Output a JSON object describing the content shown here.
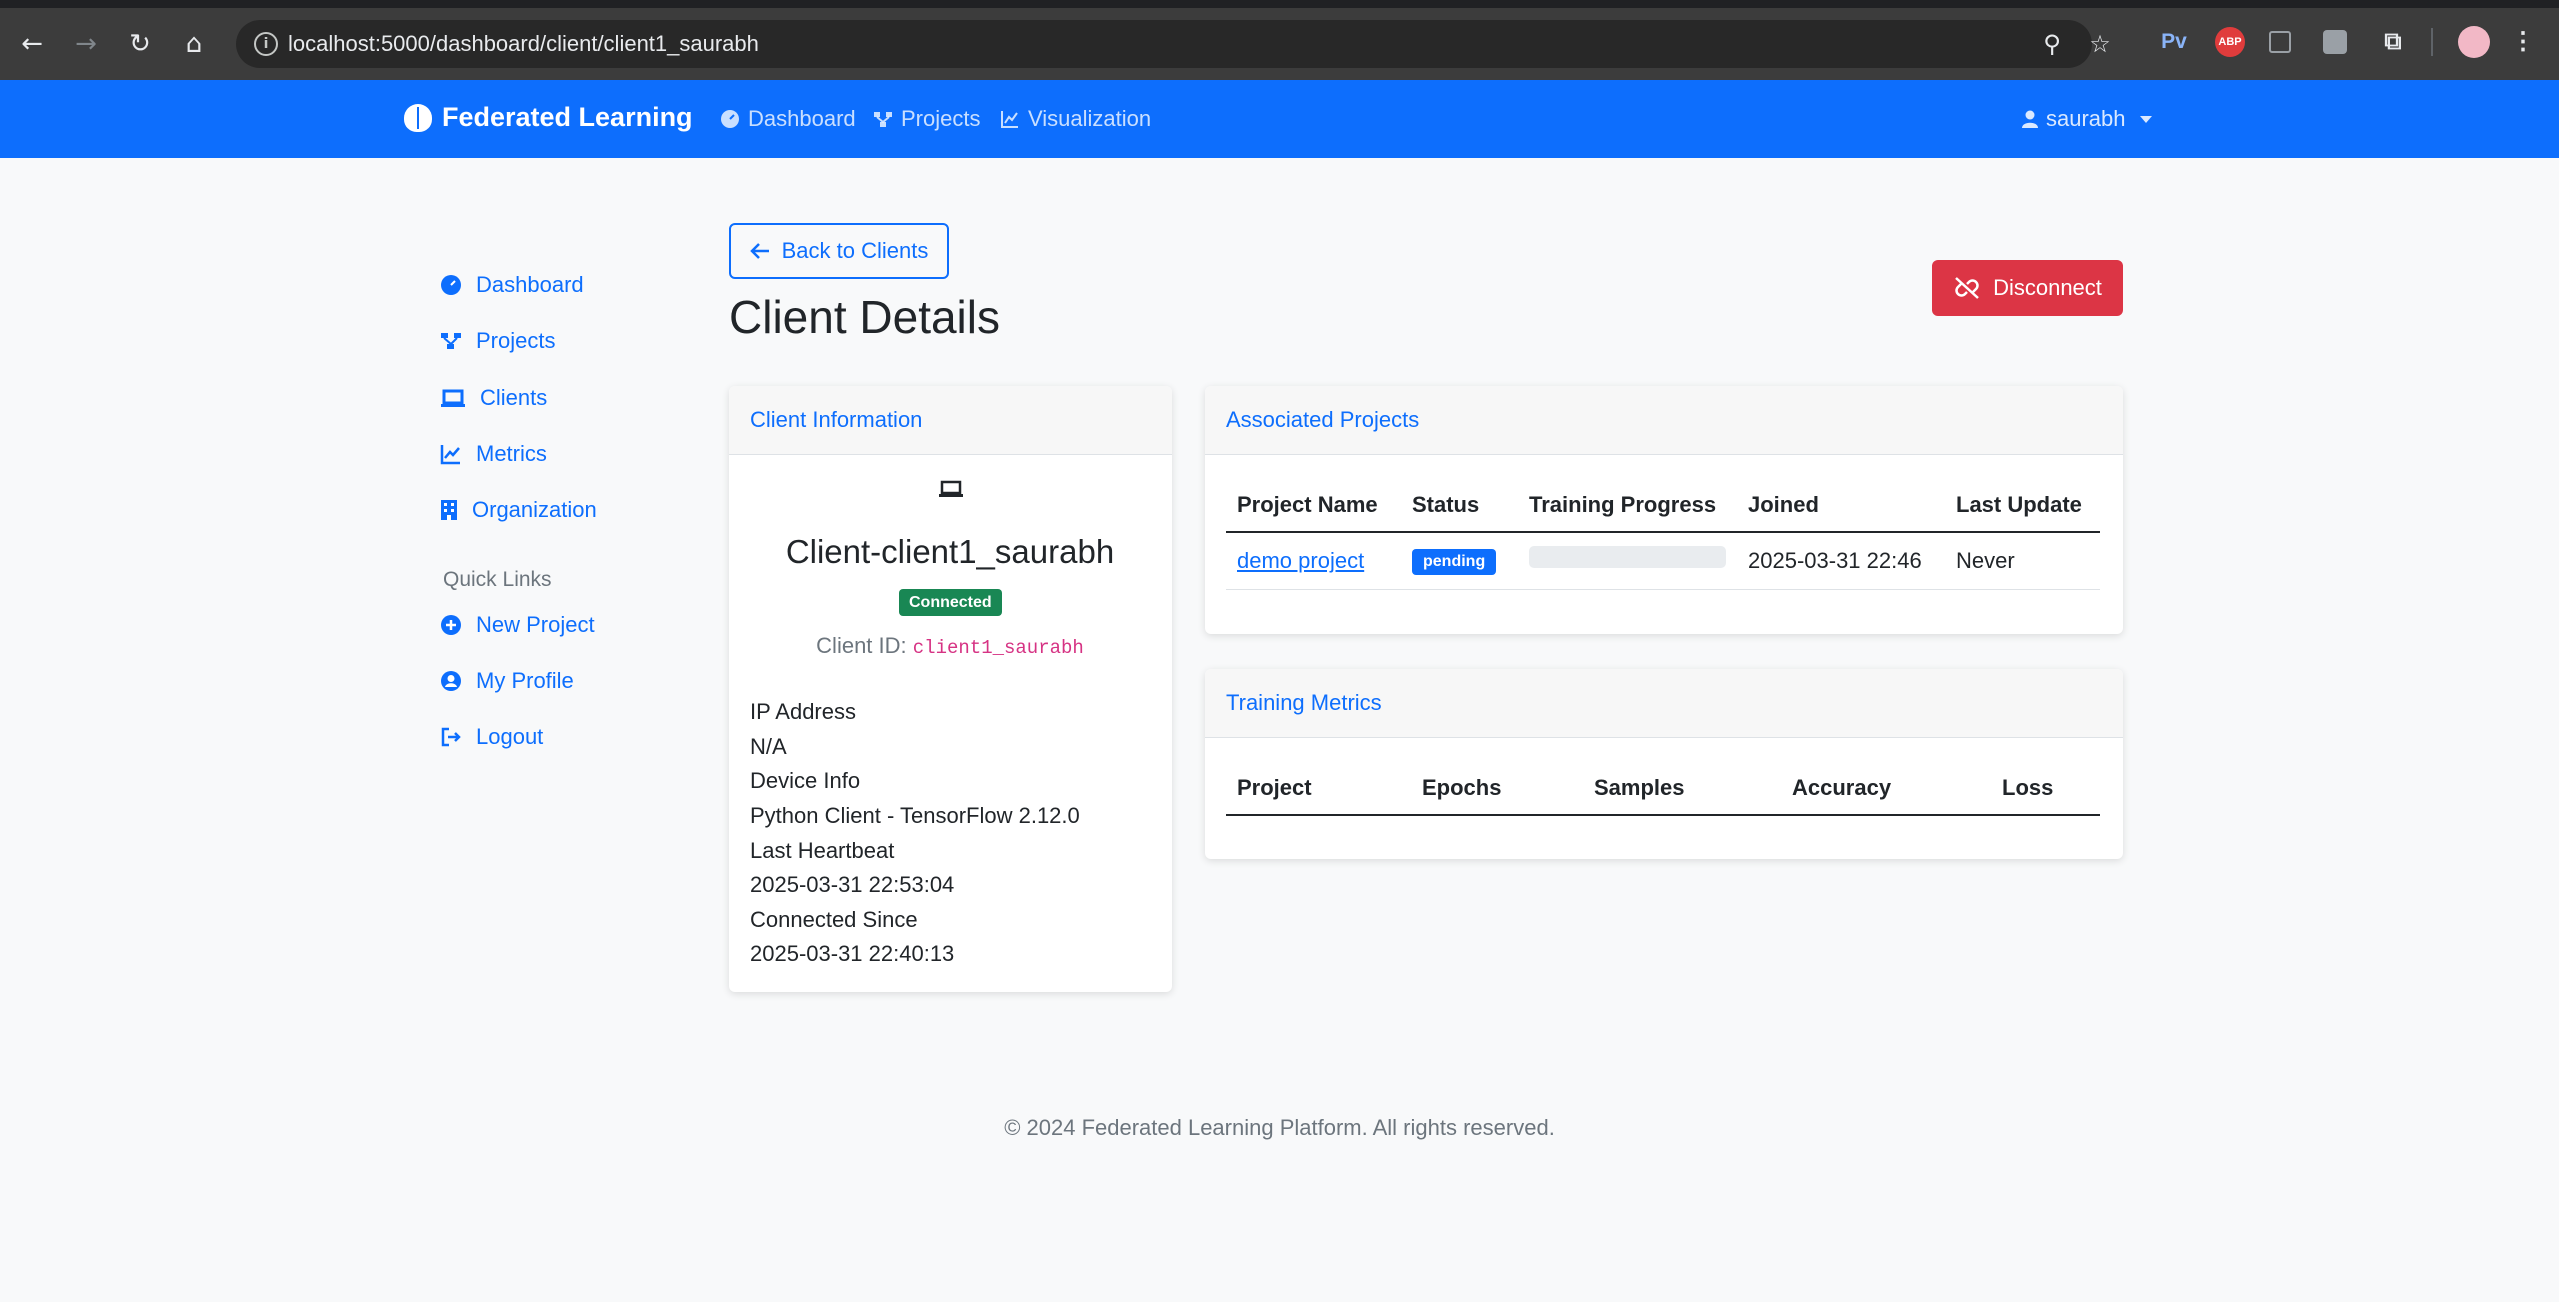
{
  "browser": {
    "url": "localhost:5000/dashboard/client/client1_saurabh",
    "extensions": [
      "Pv",
      "ABP"
    ]
  },
  "navbar": {
    "brand": "Federated Learning",
    "links": [
      "Dashboard",
      "Projects",
      "Visualization"
    ],
    "user": "saurabh"
  },
  "sidebar": {
    "items": [
      "Dashboard",
      "Projects",
      "Clients",
      "Metrics",
      "Organization"
    ],
    "quick_links_heading": "Quick Links",
    "quick_links": [
      "New Project",
      "My Profile",
      "Logout"
    ]
  },
  "main": {
    "back_button": "Back to Clients",
    "title": "Client Details",
    "disconnect_button": "Disconnect"
  },
  "client_info": {
    "header": "Client Information",
    "name": "Client-client1_saurabh",
    "status": "Connected",
    "id_label": "Client ID:",
    "id_value": "client1_saurabh",
    "ip_label": "IP Address",
    "ip_value": "N/A",
    "device_label": "Device Info",
    "device_value": "Python Client - TensorFlow 2.12.0",
    "heartbeat_label": "Last Heartbeat",
    "heartbeat_value": "2025-03-31 22:53:04",
    "since_label": "Connected Since",
    "since_value": "2025-03-31 22:40:13"
  },
  "projects": {
    "header": "Associated Projects",
    "columns": [
      "Project Name",
      "Status",
      "Training Progress",
      "Joined",
      "Last Update"
    ],
    "rows": [
      {
        "name": "demo project",
        "status": "pending",
        "progress": 0,
        "joined": "2025-03-31 22:46",
        "last_update": "Never"
      }
    ]
  },
  "metrics": {
    "header": "Training Metrics",
    "columns": [
      "Project",
      "Epochs",
      "Samples",
      "Accuracy",
      "Loss"
    ]
  },
  "footer": "© 2024 Federated Learning Platform. All rights reserved.",
  "colors": {
    "primary": "#0d6efd",
    "danger": "#dc3545",
    "success": "#198754"
  }
}
